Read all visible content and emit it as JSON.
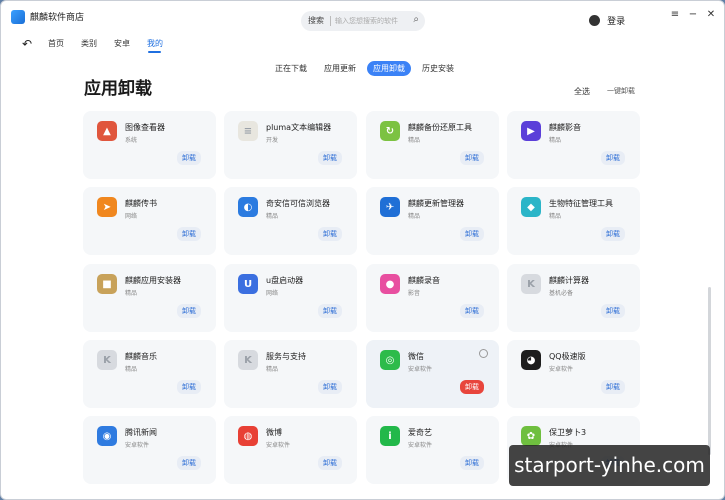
{
  "app": {
    "title": "麒麟软件商店"
  },
  "search": {
    "label": "搜索",
    "placeholder": "输入您想搜索的软件"
  },
  "user": {
    "label": "登录"
  },
  "window_controls": {
    "menu": "≡",
    "minimize": "−",
    "close": "✕"
  },
  "nav": {
    "back": "↶",
    "items": [
      "首页",
      "类别",
      "安卓",
      "我的"
    ],
    "active_index": 3
  },
  "subtabs": {
    "items": [
      "正在下载",
      "应用更新",
      "应用卸载",
      "历史安装"
    ],
    "active_index": 2
  },
  "page": {
    "title": "应用卸载",
    "select_all": "全选",
    "uninstall_all": "一键卸载"
  },
  "apps": [
    {
      "name": "图像查看器",
      "category": "系统",
      "button": "卸载",
      "color": "#e0563d",
      "icon": "image-viewer-icon",
      "glyph": "▲"
    },
    {
      "name": "pluma文本编辑器",
      "category": "开发",
      "button": "卸载",
      "color": "#e8e6df",
      "icon": "text-editor-icon",
      "glyph": "≡"
    },
    {
      "name": "麒麟备份还原工具",
      "category": "精品",
      "button": "卸载",
      "color": "#7cc242",
      "icon": "backup-icon",
      "glyph": "↻"
    },
    {
      "name": "麒麟影音",
      "category": "精品",
      "button": "卸载",
      "color": "#5b3fd9",
      "icon": "video-player-icon",
      "glyph": "▶"
    },
    {
      "name": "麒麟传书",
      "category": "网络",
      "button": "卸载",
      "color": "#f0871f",
      "icon": "file-transfer-icon",
      "glyph": "➤"
    },
    {
      "name": "奇安信可信浏览器",
      "category": "精品",
      "button": "卸载",
      "color": "#2b7be0",
      "icon": "browser-icon",
      "glyph": "◐"
    },
    {
      "name": "麒麟更新管理器",
      "category": "精品",
      "button": "卸载",
      "color": "#1f6fd6",
      "icon": "update-manager-icon",
      "glyph": "✈"
    },
    {
      "name": "生物特征管理工具",
      "category": "精品",
      "button": "卸载",
      "color": "#2bb5c8",
      "icon": "biometric-icon",
      "glyph": "◆"
    },
    {
      "name": "麒麟应用安装器",
      "category": "精品",
      "button": "卸载",
      "color": "#c8a25a",
      "icon": "installer-icon",
      "glyph": "■"
    },
    {
      "name": "u盘启动器",
      "category": "网络",
      "button": "卸载",
      "color": "#3b6fe0",
      "icon": "usb-boot-icon",
      "glyph": "U"
    },
    {
      "name": "麒麟录音",
      "category": "影音",
      "button": "卸载",
      "color": "#e84fa0",
      "icon": "recorder-icon",
      "glyph": "●"
    },
    {
      "name": "麒麟计算器",
      "category": "基机必备",
      "button": "卸载",
      "color": "#d7dadf",
      "icon": "calculator-icon",
      "glyph": "K"
    },
    {
      "name": "麒麟音乐",
      "category": "精品",
      "button": "卸载",
      "color": "#d7dadf",
      "icon": "music-icon",
      "glyph": "K"
    },
    {
      "name": "服务与支持",
      "category": "精品",
      "button": "卸载",
      "color": "#d7dadf",
      "icon": "support-icon",
      "glyph": "K"
    },
    {
      "name": "微信",
      "category": "安卓软件",
      "button": "卸载",
      "color": "#2dbb4a",
      "icon": "wechat-icon",
      "glyph": "◎",
      "highlight": true
    },
    {
      "name": "QQ极速版",
      "category": "安卓软件",
      "button": "卸载",
      "color": "#1e1e1e",
      "icon": "qq-icon",
      "glyph": "◕"
    },
    {
      "name": "腾讯新闻",
      "category": "安卓软件",
      "button": "卸载",
      "color": "#2f7be0",
      "icon": "tencent-news-icon",
      "glyph": "◉"
    },
    {
      "name": "微博",
      "category": "安卓软件",
      "button": "卸载",
      "color": "#e84035",
      "icon": "weibo-icon",
      "glyph": "◍"
    },
    {
      "name": "爱奇艺",
      "category": "安卓软件",
      "button": "卸载",
      "color": "#22b84a",
      "icon": "iqiyi-icon",
      "glyph": "i"
    },
    {
      "name": "保卫萝卜3",
      "category": "安卓软件",
      "button": "卸载",
      "color": "#6fbf3f",
      "icon": "game-icon",
      "glyph": "✿"
    }
  ],
  "watermark": {
    "text": "starport-yinhe.com"
  }
}
